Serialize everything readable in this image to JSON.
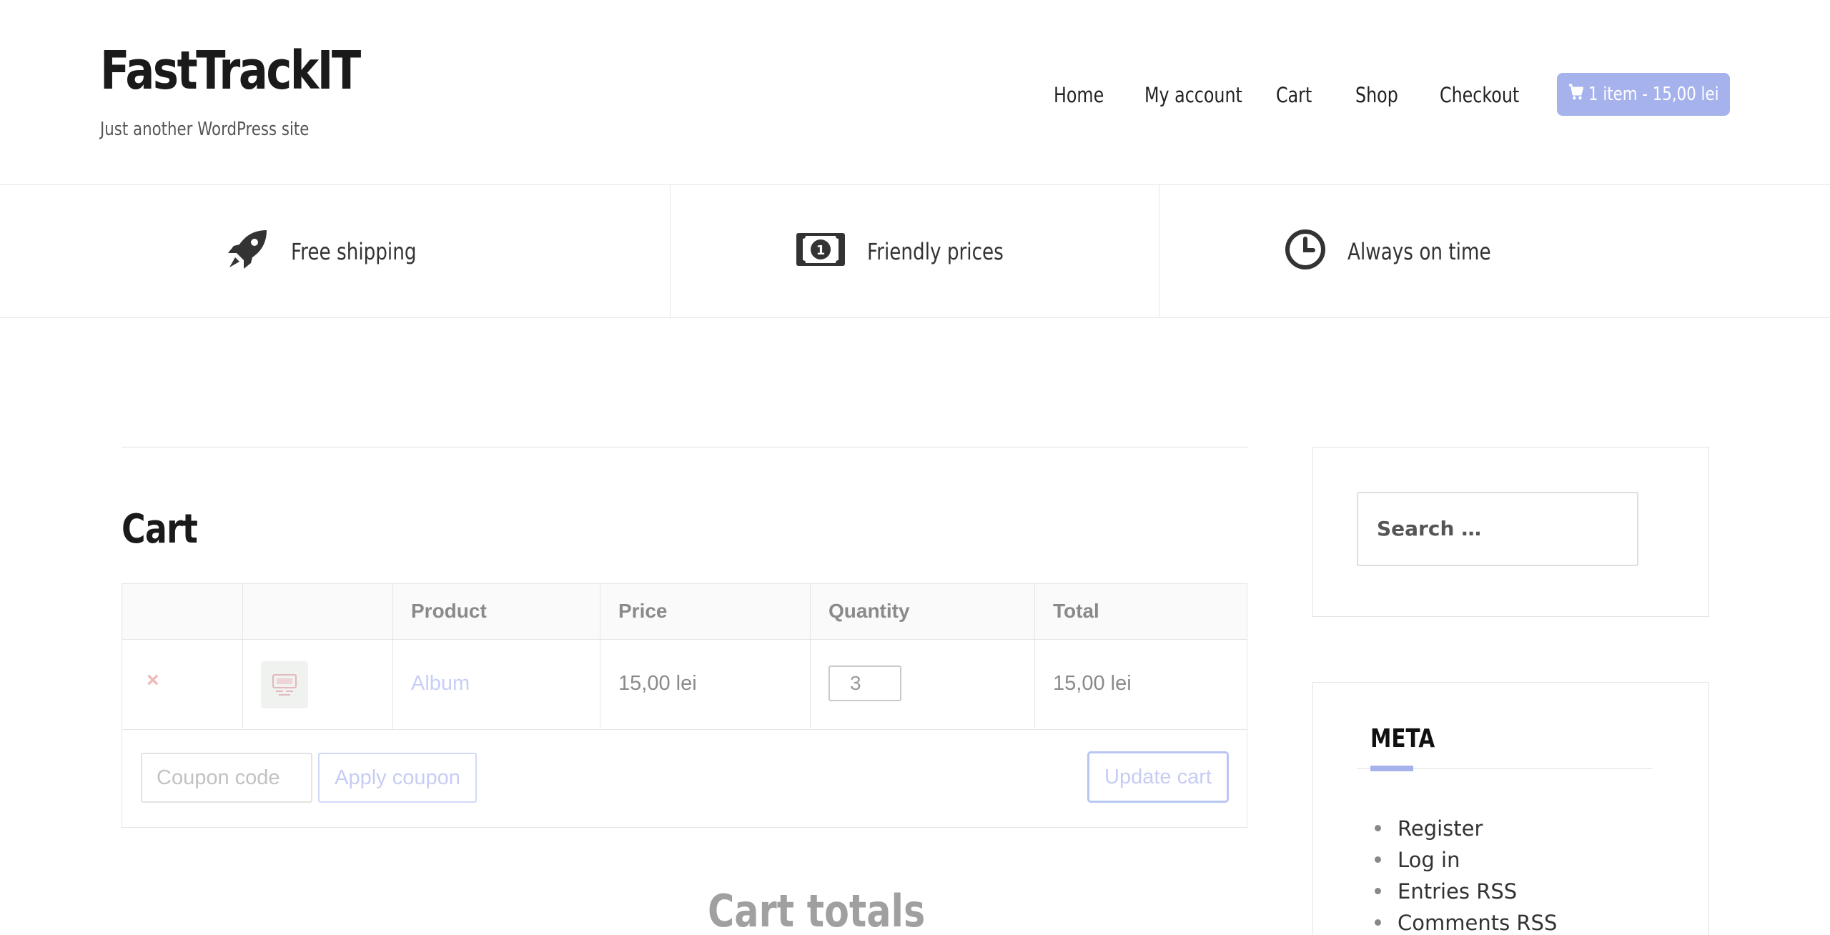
{
  "site": {
    "title": "FastTrackIT",
    "tagline": "Just another WordPress site"
  },
  "nav": {
    "items": [
      {
        "label": "Home"
      },
      {
        "label": "My account"
      },
      {
        "label": "Cart"
      },
      {
        "label": "Shop"
      },
      {
        "label": "Checkout"
      }
    ],
    "cart_summary": "1 item - 15,00 lei"
  },
  "features": [
    {
      "icon": "rocket-icon",
      "label": "Free shipping"
    },
    {
      "icon": "money-icon",
      "label": "Friendly prices"
    },
    {
      "icon": "clock-icon",
      "label": "Always on time"
    }
  ],
  "page": {
    "title": "Cart"
  },
  "cart": {
    "columns": [
      "",
      "",
      "Product",
      "Price",
      "Quantity",
      "Total"
    ],
    "items": [
      {
        "product": "Album",
        "price": "15,00 lei",
        "quantity": "3",
        "total": "15,00 lei"
      }
    ],
    "coupon_placeholder": "Coupon code",
    "apply_coupon_label": "Apply coupon",
    "update_cart_label": "Update cart"
  },
  "cart_totals": {
    "title": "Cart totals"
  },
  "sidebar": {
    "search_placeholder": "Search …",
    "meta": {
      "title": "META",
      "links": [
        "Register",
        "Log in",
        "Entries RSS",
        "Comments RSS"
      ]
    }
  },
  "colors": {
    "accent": "#a6b2ec",
    "remove": "#f0b8b8"
  }
}
